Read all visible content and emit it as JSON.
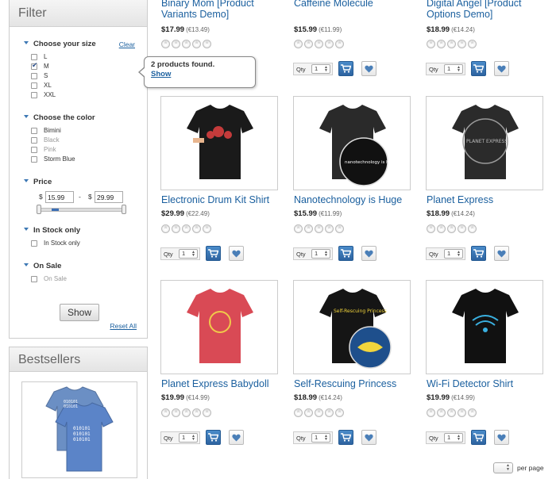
{
  "filter": {
    "title": "Filter",
    "size": {
      "title": "Choose your size",
      "clear_label": "Clear",
      "options": [
        {
          "label": "L",
          "checked": false
        },
        {
          "label": "M",
          "checked": true
        },
        {
          "label": "S",
          "checked": false
        },
        {
          "label": "XL",
          "checked": false
        },
        {
          "label": "XXL",
          "checked": false
        }
      ]
    },
    "color": {
      "title": "Choose the color",
      "options": [
        {
          "label": "Bimini",
          "available": true
        },
        {
          "label": "Black",
          "available": false
        },
        {
          "label": "Pink",
          "available": false
        },
        {
          "label": "Storm Blue",
          "available": true
        }
      ]
    },
    "price": {
      "title": "Price",
      "currency": "$",
      "min": "15.99",
      "max": "29.99",
      "separator": "-"
    },
    "stock": {
      "title": "In Stock only",
      "option_label": "In Stock only"
    },
    "sale": {
      "title": "On Sale",
      "option_label": "On Sale"
    },
    "show_label": "Show",
    "reset_label": "Reset All"
  },
  "tooltip": {
    "text": "2 products found.",
    "link": "Show"
  },
  "bestsellers": {
    "title": "Bestsellers"
  },
  "products": [
    {
      "name": "Binary Mom [Product Variants Demo]",
      "price": "$17.99",
      "alt_price": "(€13.49)"
    },
    {
      "name": "Caffeine Molecule",
      "price": "$15.99",
      "alt_price": "(€11.99)"
    },
    {
      "name": "Digital Angel [Product Options Demo]",
      "price": "$18.99",
      "alt_price": "(€14.24)"
    },
    {
      "name": "Electronic Drum Kit Shirt",
      "price": "$29.99",
      "alt_price": "(€22.49)"
    },
    {
      "name": "Nanotechnology is Huge",
      "price": "$15.99",
      "alt_price": "(€11.99)"
    },
    {
      "name": "Planet Express",
      "price": "$18.99",
      "alt_price": "(€14.24)"
    },
    {
      "name": "Planet Express Babydoll",
      "price": "$19.99",
      "alt_price": "(€14.99)"
    },
    {
      "name": "Self-Rescuing Princess",
      "price": "$18.99",
      "alt_price": "(€14.24)"
    },
    {
      "name": "Wi-Fi Detector Shirt",
      "price": "$19.99",
      "alt_price": "(€14.99)"
    }
  ],
  "product_images": [
    {
      "tshirt_color": "#1a1a1a",
      "print_text": ""
    },
    {
      "tshirt_color": "#2a2a2a",
      "print_text": "nanotechnology is huge."
    },
    {
      "tshirt_color": "#2b2b2b",
      "print_text": "PLANET EXPRESS"
    },
    {
      "tshirt_color": "#d94a55",
      "print_text": ""
    },
    {
      "tshirt_color": "#151515",
      "print_text": "Self-Rescuing Princess"
    },
    {
      "tshirt_color": "#111111",
      "print_text": ""
    }
  ],
  "shirt_print_lines": [
    "010101",
    "010101",
    "010101"
  ],
  "qty_label": "Qty",
  "qty_value": "1",
  "per_page_label": "per page",
  "colors": {
    "link": "#1a5f9e",
    "accent": "#3b6fb5",
    "cart_button": "#2d63a0"
  },
  "icons": {
    "cart": "cart-icon",
    "wishlist": "heart-icon",
    "section_toggle": "triangle-down-icon"
  }
}
